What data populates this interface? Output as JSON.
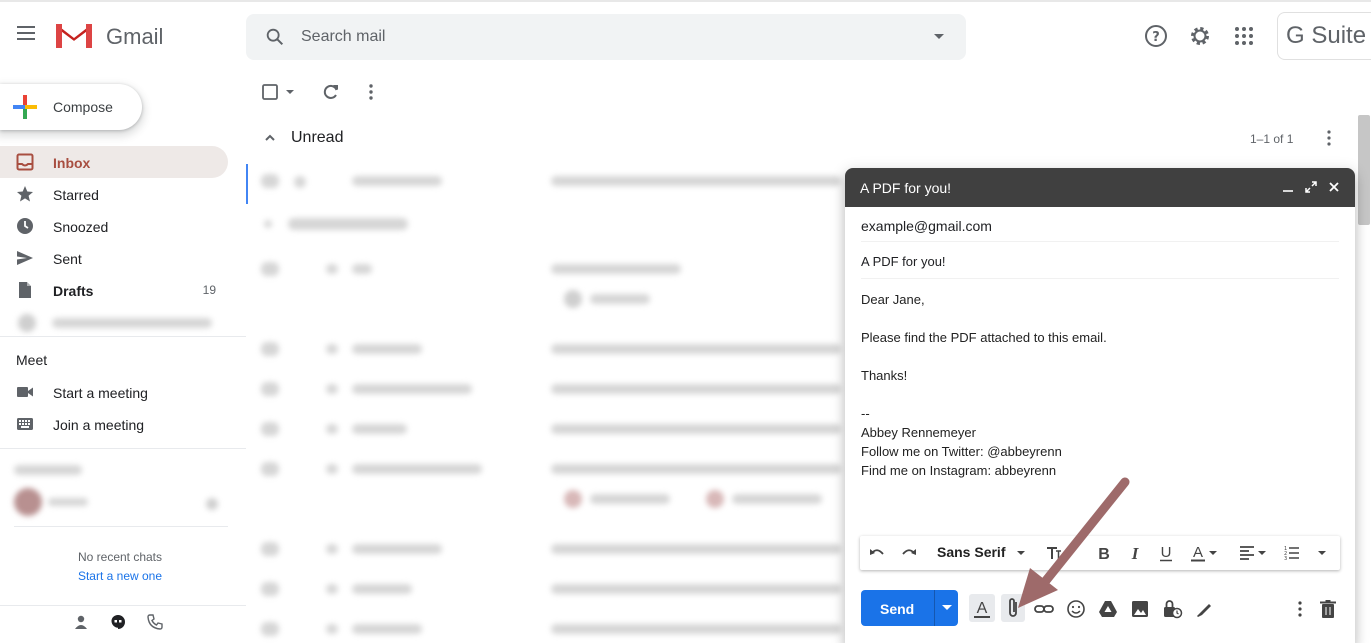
{
  "app": {
    "logo_text": "Gmail",
    "brand_text": "G Suite",
    "search_placeholder": "Search mail"
  },
  "sidebar": {
    "compose_label": "Compose",
    "items": [
      {
        "label": "Inbox",
        "count": ""
      },
      {
        "label": "Starred",
        "count": ""
      },
      {
        "label": "Snoozed",
        "count": ""
      },
      {
        "label": "Sent",
        "count": ""
      },
      {
        "label": "Drafts",
        "count": "19"
      }
    ],
    "meet_title": "Meet",
    "meet_items": [
      {
        "label": "Start a meeting"
      },
      {
        "label": "Join a meeting"
      }
    ],
    "no_chats": "No recent chats",
    "start_new": "Start a new one"
  },
  "main": {
    "section_title": "Unread",
    "pagination": "1–1 of 1"
  },
  "compose_window": {
    "title": "A PDF for you!",
    "to": "example@gmail.com",
    "subject": "A PDF for you!",
    "body": {
      "greeting": "Dear Jane,",
      "line1": "Please find the PDF attached to this email.",
      "thanks": "Thanks!",
      "sig_sep": "--",
      "sig_name": "Abbey Rennemeyer",
      "sig_twitter": "Follow me on Twitter: @abbeyrenn",
      "sig_instagram": "Find me on Instagram: abbeyrenn"
    },
    "font_name": "Sans Serif",
    "send_label": "Send"
  },
  "colors": {
    "accent_blue": "#1a73e8",
    "inbox_active": "#a84e40",
    "compose_header": "#404040",
    "annotation_arrow": "#9e6a6a"
  }
}
